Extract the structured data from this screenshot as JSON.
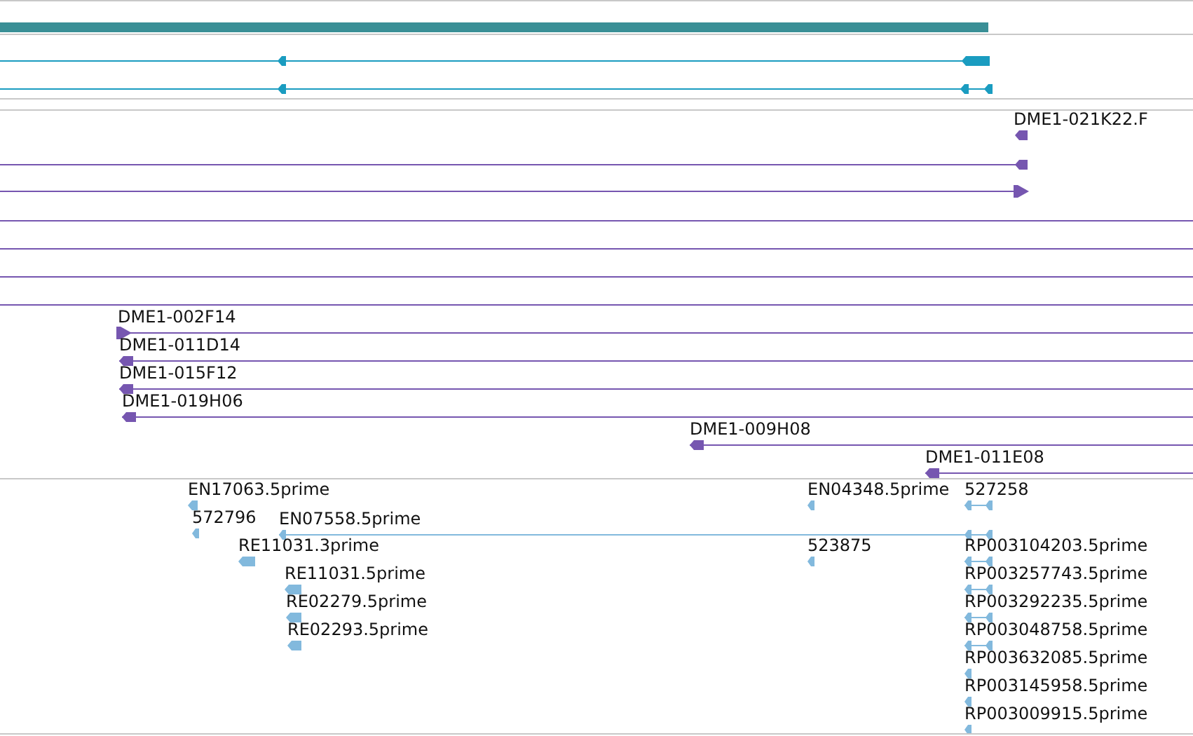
{
  "tracks": [
    {
      "kind": "gene"
    },
    {
      "kind": "transcript",
      "features": [
        {
          "arrowhead": true,
          "forward": false
        },
        {
          "arrowhead": true,
          "forward": false
        }
      ]
    },
    {
      "kind": "clone",
      "features": [
        {
          "label": "DME1-021K22.F",
          "arrowhead": true,
          "forward": false
        },
        {
          "arrowhead": true,
          "forward": false
        },
        {
          "arrowhead": true,
          "forward": true
        },
        {
          "arrowhead": false
        },
        {
          "arrowhead": false
        },
        {
          "arrowhead": false
        },
        {
          "arrowhead": false
        },
        {
          "label": "DME1-002F14",
          "arrowhead": true,
          "forward": true
        },
        {
          "label": "DME1-011D14",
          "arrowhead": true,
          "forward": false
        },
        {
          "label": "DME1-015F12",
          "arrowhead": true,
          "forward": false
        },
        {
          "label": "DME1-019H06",
          "arrowhead": true,
          "forward": false
        },
        {
          "label": "DME1-009H08",
          "arrowhead": true,
          "forward": false
        },
        {
          "label": "DME1-011E08",
          "arrowhead": true,
          "forward": false
        }
      ]
    },
    {
      "kind": "est",
      "features": [
        {
          "label": "EN17063.5prime",
          "arrowhead": true,
          "forward": false
        },
        {
          "label": "EN04348.5prime",
          "arrowhead": true,
          "forward": false
        },
        {
          "label": "527258",
          "arrowhead": true,
          "forward": false
        },
        {
          "label": "572796",
          "arrowhead": true,
          "forward": false
        },
        {
          "label": "EN07558.5prime",
          "arrowhead": true,
          "forward": false
        },
        {
          "label": "RE11031.3prime",
          "arrowhead": true,
          "forward": false
        },
        {
          "label": "523875",
          "arrowhead": true,
          "forward": false
        },
        {
          "label": "RP003104203.5prime",
          "arrowhead": true,
          "forward": false
        },
        {
          "label": "RE11031.5prime",
          "arrowhead": true,
          "forward": false
        },
        {
          "label": "RP003257743.5prime",
          "arrowhead": true,
          "forward": false
        },
        {
          "label": "RE02279.5prime",
          "arrowhead": true,
          "forward": false
        },
        {
          "label": "RP003292235.5prime",
          "arrowhead": true,
          "forward": false
        },
        {
          "label": "RE02293.5prime",
          "arrowhead": true,
          "forward": false
        },
        {
          "label": "RP003048758.5prime",
          "arrowhead": true,
          "forward": false
        },
        {
          "label": "RP003632085.5prime",
          "arrowhead": true,
          "forward": false
        },
        {
          "label": "RP003145958.5prime",
          "arrowhead": true,
          "forward": false
        },
        {
          "label": "RP003009915.5prime",
          "arrowhead": true,
          "forward": false
        }
      ]
    }
  ]
}
